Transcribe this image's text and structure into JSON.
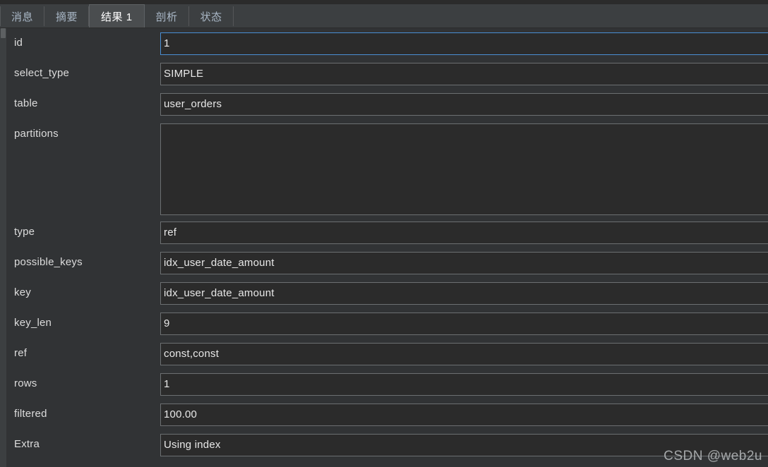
{
  "tabs": [
    {
      "label": "消息",
      "active": false
    },
    {
      "label": "摘要",
      "active": false
    },
    {
      "label": "结果 1",
      "active": true
    },
    {
      "label": "剖析",
      "active": false
    },
    {
      "label": "状态",
      "active": false
    }
  ],
  "rows": [
    {
      "label": "id",
      "value": "1",
      "focused": true,
      "multiline": false
    },
    {
      "label": "select_type",
      "value": "SIMPLE",
      "focused": false,
      "multiline": false
    },
    {
      "label": "table",
      "value": "user_orders",
      "focused": false,
      "multiline": false
    },
    {
      "label": "partitions",
      "value": "",
      "focused": false,
      "multiline": true
    },
    {
      "label": "type",
      "value": "ref",
      "focused": false,
      "multiline": false
    },
    {
      "label": "possible_keys",
      "value": "idx_user_date_amount",
      "focused": false,
      "multiline": false
    },
    {
      "label": "key",
      "value": "idx_user_date_amount",
      "focused": false,
      "multiline": false
    },
    {
      "label": "key_len",
      "value": "9",
      "focused": false,
      "multiline": false
    },
    {
      "label": "ref",
      "value": "const,const",
      "focused": false,
      "multiline": false
    },
    {
      "label": "rows",
      "value": "1",
      "focused": false,
      "multiline": false
    },
    {
      "label": "filtered",
      "value": "100.00",
      "focused": false,
      "multiline": false
    },
    {
      "label": "Extra",
      "value": "Using index",
      "focused": false,
      "multiline": false
    }
  ],
  "watermark": {
    "text": "CSDN @web2u"
  },
  "colors": {
    "background": "#313335",
    "field_background": "#2b2b2b",
    "field_border": "#6c6f71",
    "focus_border": "#4a8fd4",
    "tabbar_background": "#3c3f41",
    "active_tab_background": "#4a4d4f",
    "label_text": "#dcdcdc",
    "inactive_tab_text": "#a9b7c6"
  }
}
